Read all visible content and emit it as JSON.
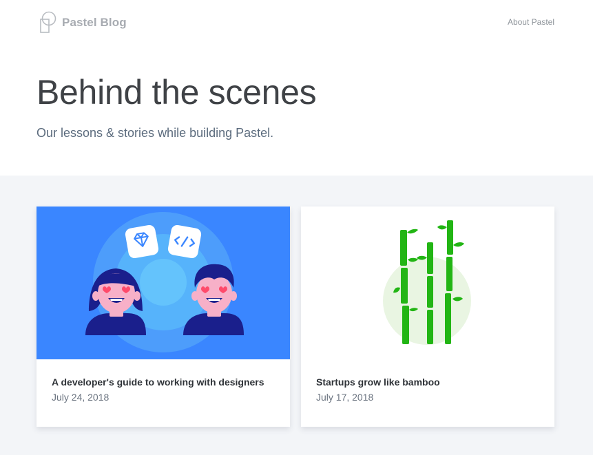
{
  "header": {
    "brand": "Pastel Blog",
    "about_link": "About Pastel"
  },
  "hero": {
    "title": "Behind the scenes",
    "subtitle": "Our lessons & stories while building Pastel."
  },
  "posts": [
    {
      "title": "A developer's guide to working with designers",
      "date": "July 24, 2018",
      "image": "designer-developer-illustration"
    },
    {
      "title": "Startups grow like bamboo",
      "date": "July 17, 2018",
      "image": "bamboo-illustration"
    }
  ],
  "colors": {
    "card1_background": "#3a86ff",
    "bamboo_green": "#22b514",
    "section_background": "#f3f5f8"
  }
}
